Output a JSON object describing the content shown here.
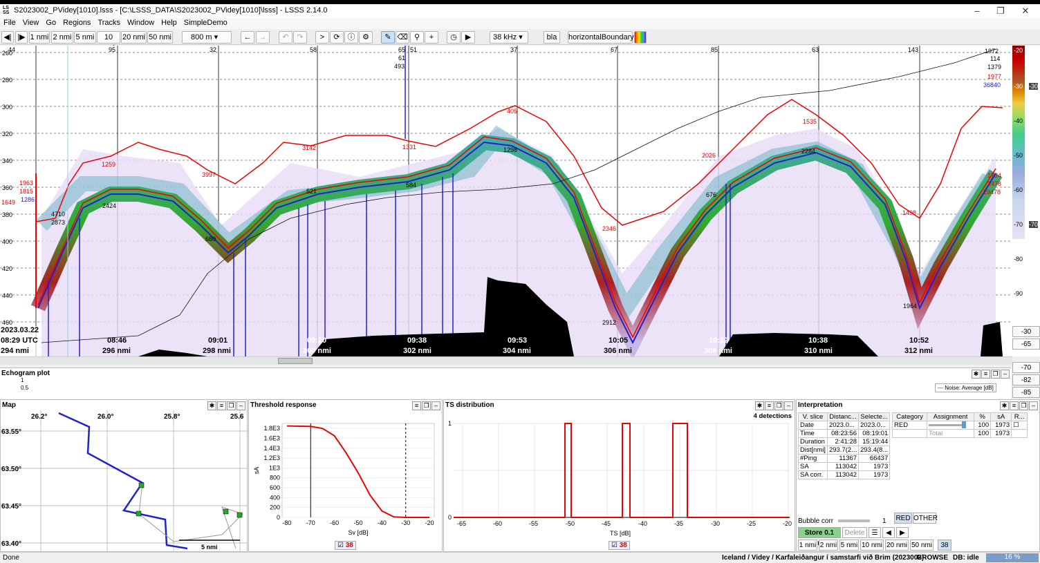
{
  "window": {
    "title": "S2023002_PVidey[1010].lsss - [C:\\LSSS_DATA\\S2023002_PVidey[1010]\\lsss] - LSSS 2.14.0",
    "icon_text": "LSSS"
  },
  "menu": [
    "File",
    "View",
    "Go",
    "Regions",
    "Tracks",
    "Window",
    "Help",
    "SimpleDemo"
  ],
  "toolbar": {
    "distances": [
      "1 nmi",
      "2 nmi",
      "5 nmi",
      "10 nmi",
      "20 nmi",
      "50 nmi"
    ],
    "range": "800 m",
    "frequency": "38 kHz",
    "bla": "bla",
    "boundary": "horizontalBoundary"
  },
  "echogram": {
    "depth_ticks": [
      "260",
      "280",
      "300",
      "320",
      "340",
      "360",
      "380",
      "400",
      "420",
      "440",
      "460"
    ],
    "date": "2023.03.22",
    "time_start": "08:29 UTC",
    "dist_start": "294 nmi",
    "time_labels": [
      "08:46",
      "09:01",
      "09:20",
      "09:38",
      "09:53",
      "10:05",
      "10:22",
      "10:38",
      "10:52"
    ],
    "dist_labels": [
      "296 nmi",
      "298 nmi",
      "300 nmi",
      "302 nmi",
      "304 nmi",
      "306 nmi",
      "308 nmi",
      "310 nmi",
      "312 nmi"
    ],
    "top_numbers": [
      "44",
      "95",
      "32",
      "58",
      "65",
      "51",
      "37",
      "67",
      "85",
      "63",
      "143"
    ],
    "annotations": [
      "1963",
      "1815",
      "1286",
      "1649",
      "4710",
      "2873",
      "1259",
      "3142",
      "3997",
      "2424",
      "680",
      "521",
      "1331",
      "584",
      "1298",
      "405",
      "2346",
      "2912",
      "2026",
      "676",
      "1535",
      "2284",
      "1498",
      "1964",
      "1734",
      "1478",
      "29478",
      "1972",
      "114",
      "1379",
      "1977",
      "36840",
      "61",
      "493"
    ]
  },
  "colorbar": {
    "ticks": [
      "-20",
      "-30",
      "-40",
      "-50",
      "-60",
      "-70",
      "-80",
      "-90"
    ],
    "right_labels": [
      "-30",
      "-70"
    ],
    "buttons": [
      "-30",
      "-65",
      "-70",
      "-82",
      "-85"
    ]
  },
  "echogram_plot": {
    "title": "Echogram plot",
    "yticks": [
      "1",
      "0.5"
    ],
    "legend": "Noise: Average [dB]"
  },
  "map": {
    "title": "Map",
    "lon": [
      "26.2°",
      "26.0°",
      "25.8°",
      "25.6"
    ],
    "lat": [
      "63.55°",
      "63.50°",
      "63.45°",
      "63.40°"
    ],
    "scale": "5 nmi"
  },
  "threshold": {
    "title": "Threshold response",
    "ylabel": "sA",
    "xlabel": "Sv [dB]",
    "yticks": [
      "1.8E3",
      "1.6E3",
      "1.4E3",
      "1.2E3",
      "1E3",
      "800",
      "600",
      "400",
      "200",
      "0"
    ],
    "xticks": [
      "-80",
      "-70",
      "-60",
      "-50",
      "-40",
      "-30",
      "-20"
    ],
    "checkbox": "38"
  },
  "ts": {
    "title": "TS distribution",
    "detections": "4 detections",
    "xlabel": "TS [dB]",
    "xticks": [
      "-65",
      "-60",
      "-55",
      "-50",
      "-45",
      "-40",
      "-35",
      "-30",
      "-25",
      "-20"
    ],
    "yticks": [
      "1",
      "0"
    ],
    "checkbox": "38"
  },
  "interp": {
    "title": "Interpretation",
    "headers": [
      "V. slice",
      "Distanc...",
      "Selecte..."
    ],
    "rows": [
      [
        "Date",
        "2023.0...",
        "2023.0..."
      ],
      [
        "Time",
        "08:23:56",
        "08:19:01"
      ],
      [
        "Duration",
        "2:41:28",
        "15:19:44"
      ],
      [
        "Dist[nmi]",
        "293.7(2...",
        "293.4(8..."
      ],
      [
        "#Ping",
        "11367",
        "66437"
      ],
      [
        "SA",
        "113042",
        "1973"
      ],
      [
        "SA corr.",
        "113042",
        "1973"
      ]
    ],
    "cat_headers": [
      "Category",
      "Assignment",
      "%",
      "sA",
      "R..."
    ],
    "cat_rows": [
      [
        "RED",
        "",
        "100",
        "1973"
      ],
      [
        "",
        "Total",
        "100",
        "1973"
      ]
    ],
    "bubble": "Bubble corr",
    "bubble_val": "1",
    "store": "Store 0.1 nmi",
    "delete": "Delete",
    "red": "RED",
    "other": "OTHER",
    "dist_buttons": [
      "1 nmi",
      "2 nmi",
      "5 nmi",
      "10 nmi",
      "20 nmi",
      "50 nmi"
    ],
    "freq": "38"
  },
  "status": {
    "left": "Done",
    "survey": "Iceland / Videy / Karfaleiðangur í samstarfi við Brim (2023002)",
    "mode": "BROWSE",
    "db": "DB: idle",
    "progress": "16 %"
  },
  "chart_data": {
    "type": "line",
    "title": "Threshold response",
    "series": [
      {
        "values": [
          [
            -80,
            1850
          ],
          [
            -70,
            1840
          ],
          [
            -65,
            1800
          ],
          [
            -60,
            1650
          ],
          [
            -55,
            1300
          ],
          [
            -50,
            900
          ],
          [
            -45,
            450
          ],
          [
            -40,
            130
          ],
          [
            -35,
            10
          ],
          [
            -30,
            0
          ],
          [
            -20,
            0
          ]
        ]
      }
    ],
    "xlim": [
      -82,
      -18
    ],
    "ylim": [
      0,
      1900
    ]
  }
}
